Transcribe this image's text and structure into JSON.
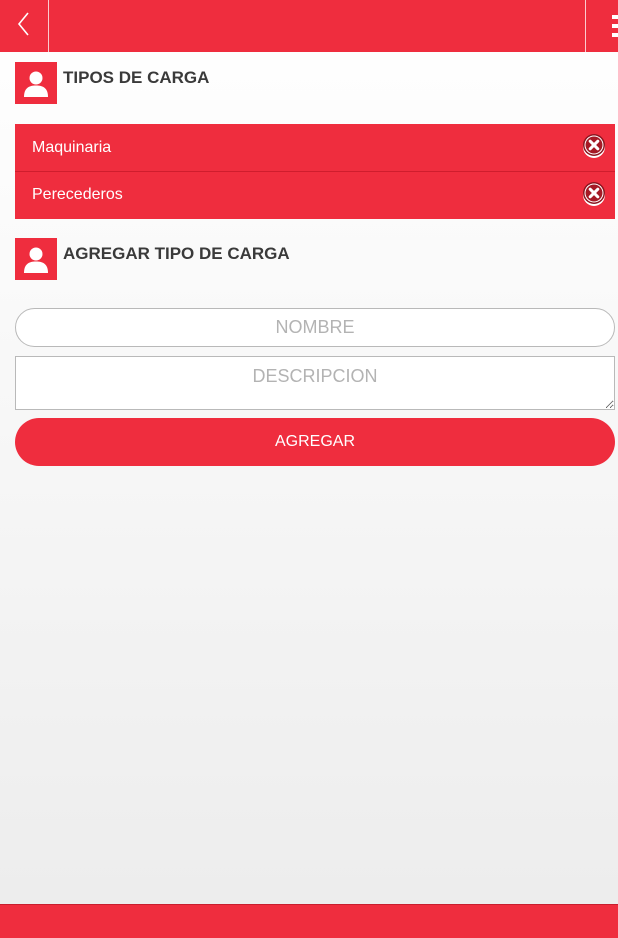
{
  "colors": {
    "accent": "#ef2d3e",
    "title_text": "#3a3a3a",
    "placeholder": "#b3b3b3"
  },
  "topbar": {
    "back_icon": "chevron-left-icon",
    "menu_icon": "menu-icon"
  },
  "cargo_types": {
    "title": "TIPOS DE CARGA",
    "icon": "user-icon",
    "items": [
      {
        "label": "Maquinaria",
        "remove_icon": "close-circle-icon"
      },
      {
        "label": "Perecederos",
        "remove_icon": "close-circle-icon"
      }
    ]
  },
  "add_form": {
    "title": "AGREGAR TIPO DE CARGA",
    "icon": "user-icon",
    "name_placeholder": "NOMBRE",
    "description_placeholder": "DESCRIPCION",
    "submit_label": "AGREGAR"
  }
}
